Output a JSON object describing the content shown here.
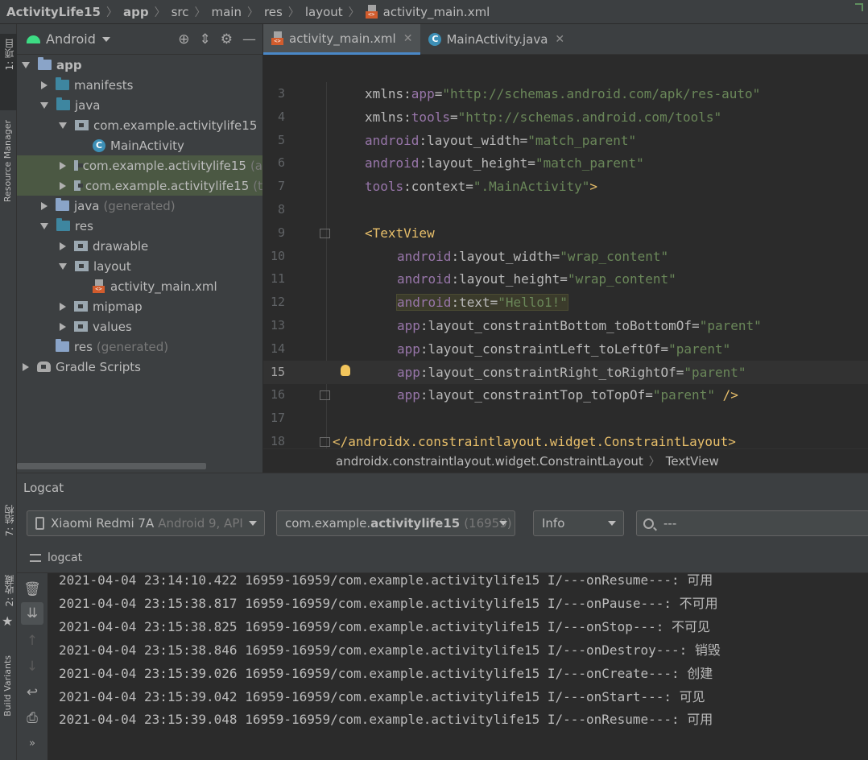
{
  "breadcrumb": [
    "ActivityLife15",
    "app",
    "src",
    "main",
    "res",
    "layout",
    "activity_main.xml"
  ],
  "left_stripe": {
    "tab_project": "1: 项目",
    "tab_resource": "Resource Manager",
    "tab_structure": "7: 结构",
    "tab_favorites": "2: 收藏",
    "tab_build_variants": "Build Variants"
  },
  "project": {
    "view_mode": "Android",
    "tree": [
      {
        "label": "app",
        "depth": 0,
        "expanded": true,
        "icon": "module-folder"
      },
      {
        "label": "manifests",
        "depth": 1,
        "expanded": false,
        "icon": "folder"
      },
      {
        "label": "java",
        "depth": 1,
        "expanded": true,
        "icon": "folder"
      },
      {
        "label": "com.example.activitylife15",
        "depth": 2,
        "expanded": true,
        "icon": "package"
      },
      {
        "label": "MainActivity",
        "depth": 3,
        "icon": "class"
      },
      {
        "label": "com.example.activitylife15",
        "suffix": "(a",
        "depth": 2,
        "expanded": false,
        "icon": "package",
        "selected": true
      },
      {
        "label": "com.example.activitylife15",
        "suffix": "(t",
        "depth": 2,
        "expanded": false,
        "icon": "package",
        "selected": true
      },
      {
        "label": "java",
        "suffix": "(generated)",
        "depth": 1,
        "expanded": false,
        "icon": "folder-gen"
      },
      {
        "label": "res",
        "depth": 1,
        "expanded": true,
        "icon": "folder"
      },
      {
        "label": "drawable",
        "depth": 2,
        "expanded": false,
        "icon": "package"
      },
      {
        "label": "layout",
        "depth": 2,
        "expanded": true,
        "icon": "package"
      },
      {
        "label": "activity_main.xml",
        "depth": 3,
        "icon": "xml"
      },
      {
        "label": "mipmap",
        "depth": 2,
        "expanded": false,
        "icon": "package"
      },
      {
        "label": "values",
        "depth": 2,
        "expanded": false,
        "icon": "package"
      },
      {
        "label": "res",
        "suffix": "(generated)",
        "depth": 1,
        "icon": "folder-gen"
      },
      {
        "label": "Gradle Scripts",
        "depth": 0,
        "expanded": false,
        "icon": "gradle"
      }
    ]
  },
  "editor": {
    "tabs": [
      {
        "label": "activity_main.xml",
        "active": true,
        "icon": "xml-icon"
      },
      {
        "label": "MainActivity.java",
        "active": false,
        "icon": "class-icon"
      }
    ],
    "lines": [
      {
        "n": "3",
        "parts": [
          [
            "attr",
            "xmlns:"
          ],
          [
            "ns",
            "app"
          ],
          [
            "attr",
            "="
          ],
          [
            "str",
            "\"http://schemas.android.com/apk/res-auto\""
          ]
        ],
        "indent": 1
      },
      {
        "n": "4",
        "parts": [
          [
            "attr",
            "xmlns:"
          ],
          [
            "ns",
            "tools"
          ],
          [
            "attr",
            "="
          ],
          [
            "str",
            "\"http://schemas.android.com/tools\""
          ]
        ],
        "indent": 1
      },
      {
        "n": "5",
        "parts": [
          [
            "ns",
            "android"
          ],
          [
            "attr",
            ":layout_width="
          ],
          [
            "str",
            "\"match_parent\""
          ]
        ],
        "indent": 1
      },
      {
        "n": "6",
        "parts": [
          [
            "ns",
            "android"
          ],
          [
            "attr",
            ":layout_height="
          ],
          [
            "str",
            "\"match_parent\""
          ]
        ],
        "indent": 1
      },
      {
        "n": "7",
        "parts": [
          [
            "ns",
            "tools"
          ],
          [
            "attr",
            ":context="
          ],
          [
            "str",
            "\".MainActivity\""
          ],
          [
            "tag",
            ">"
          ]
        ],
        "indent": 1
      },
      {
        "n": "8",
        "parts": [],
        "indent": 1
      },
      {
        "n": "9",
        "parts": [
          [
            "tag",
            "<TextView"
          ]
        ],
        "indent": 1
      },
      {
        "n": "10",
        "parts": [
          [
            "ns",
            "android"
          ],
          [
            "attr",
            ":layout_width="
          ],
          [
            "str",
            "\"wrap_content\""
          ]
        ],
        "indent": 2
      },
      {
        "n": "11",
        "parts": [
          [
            "ns",
            "android"
          ],
          [
            "attr",
            ":layout_height="
          ],
          [
            "str",
            "\"wrap_content\""
          ]
        ],
        "indent": 2
      },
      {
        "n": "12",
        "parts": [
          [
            "ns",
            "android"
          ],
          [
            "attr",
            ":text="
          ],
          [
            "str",
            "\"Hello1!\""
          ]
        ],
        "indent": 2,
        "highlight": true
      },
      {
        "n": "13",
        "parts": [
          [
            "ns",
            "app"
          ],
          [
            "attr",
            ":layout_constraintBottom_toBottomOf="
          ],
          [
            "str",
            "\"parent\""
          ]
        ],
        "indent": 2
      },
      {
        "n": "14",
        "parts": [
          [
            "ns",
            "app"
          ],
          [
            "attr",
            ":layout_constraintLeft_toLeftOf="
          ],
          [
            "str",
            "\"parent\""
          ]
        ],
        "indent": 2
      },
      {
        "n": "15",
        "parts": [
          [
            "ns",
            "app"
          ],
          [
            "attr",
            ":layout_constraintRight_toRightOf="
          ],
          [
            "str",
            "\"parent\""
          ]
        ],
        "indent": 2,
        "current": true
      },
      {
        "n": "16",
        "parts": [
          [
            "ns",
            "app"
          ],
          [
            "attr",
            ":layout_constraintTop_toTopOf="
          ],
          [
            "str",
            "\"parent\""
          ],
          [
            "tag",
            " />"
          ]
        ],
        "indent": 2
      },
      {
        "n": "17",
        "parts": [],
        "indent": 0
      },
      {
        "n": "18",
        "parts": [
          [
            "tag",
            "</androidx.constraintlayout.widget.ConstraintLayout>"
          ]
        ],
        "indent": 0
      }
    ],
    "breadcrumb": [
      "androidx.constraintlayout.widget.ConstraintLayout",
      "TextView"
    ]
  },
  "logcat": {
    "title": "Logcat",
    "device": {
      "name": "Xiaomi Redmi 7A",
      "detail": "Android 9, API"
    },
    "process": {
      "prefix": "com.example.",
      "bold": "activitylife15",
      "pid": "(16959)"
    },
    "level": "Info",
    "search_value": "---",
    "sub_label": "logcat",
    "lines": [
      "2021-04-04 23:14:10.422 16959-16959/com.example.activitylife15 I/---onResume---: 可用",
      "2021-04-04 23:15:38.817 16959-16959/com.example.activitylife15 I/---onPause---: 不可用",
      "2021-04-04 23:15:38.825 16959-16959/com.example.activitylife15 I/---onStop---: 不可见",
      "2021-04-04 23:15:38.846 16959-16959/com.example.activitylife15 I/---onDestroy---: 销毁",
      "2021-04-04 23:15:39.026 16959-16959/com.example.activitylife15 I/---onCreate---: 创建",
      "2021-04-04 23:15:39.042 16959-16959/com.example.activitylife15 I/---onStart---: 可见",
      "2021-04-04 23:15:39.048 16959-16959/com.example.activitylife15 I/---onResume---: 可用"
    ]
  },
  "colors": {
    "accent": "#4a88c7",
    "selection": "#4b5843",
    "string": "#6a8759",
    "namespace": "#9876aa",
    "tag": "#e8bf6a"
  }
}
